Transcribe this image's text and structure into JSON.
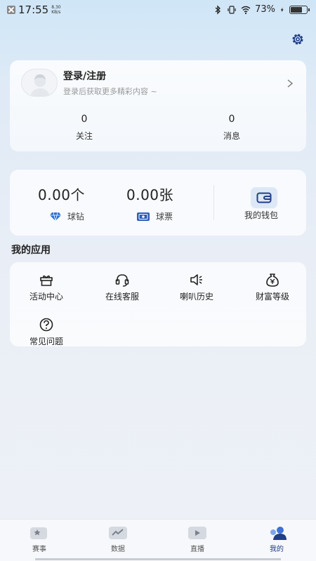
{
  "status_bar": {
    "time": "17:55",
    "net_speed": "8.30",
    "net_unit": "KB/s",
    "battery": "73%",
    "battery_level": 0.73
  },
  "profile": {
    "title": "登录/注册",
    "subtitle": "登录后获取更多精彩内容 ~",
    "stats": [
      {
        "value": "0",
        "label": "关注"
      },
      {
        "value": "0",
        "label": "消息"
      }
    ]
  },
  "wallet": {
    "diamond_amount": "0.00个",
    "diamond_label": "球钻",
    "ticket_amount": "0.00张",
    "ticket_label": "球票",
    "wallet_label": "我的钱包"
  },
  "apps": {
    "title": "我的应用",
    "items": [
      {
        "label": "活动中心",
        "icon": "gift-box-icon"
      },
      {
        "label": "在线客服",
        "icon": "headset-icon"
      },
      {
        "label": "喇叭历史",
        "icon": "speaker-icon"
      },
      {
        "label": "财富等级",
        "icon": "money-bag-icon"
      },
      {
        "label": "常见问题",
        "icon": "question-icon"
      }
    ]
  },
  "bottom_nav": {
    "items": [
      {
        "label": "赛事",
        "icon": "events-icon"
      },
      {
        "label": "数据",
        "icon": "data-chart-icon"
      },
      {
        "label": "直播",
        "icon": "live-play-icon"
      },
      {
        "label": "我的",
        "icon": "profile-icon",
        "active": true
      }
    ]
  },
  "colors": {
    "accent": "#1f3f86",
    "diamond": "#2f6fd1",
    "ticket": "#2c5fb8",
    "wallet_bg": "#dde8f7"
  }
}
